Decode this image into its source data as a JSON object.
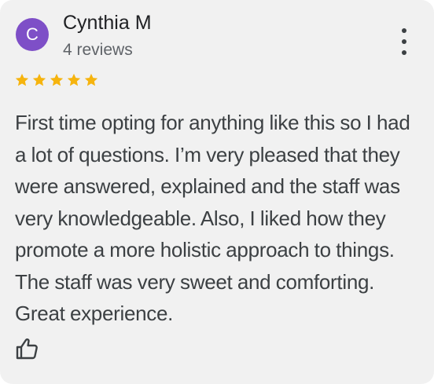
{
  "reviewer": {
    "initial": "C",
    "name": "Cynthia M",
    "review_count": "4 reviews",
    "avatar_color": "#7e4fc7"
  },
  "rating": {
    "stars": 5,
    "max": 5,
    "star_color": "#f6b40e"
  },
  "review": {
    "text": "First time opting for anything like this so I had a lot of questions. I’m very pleased that they were answered, explained and the staff was very knowledgeable. Also, I liked how they promote a more holistic approach to things. The staff was very sweet and comforting. Great experience."
  },
  "icons": {
    "more": "more-vert-icon",
    "like": "thumbs-up-icon",
    "star": "star-icon"
  }
}
